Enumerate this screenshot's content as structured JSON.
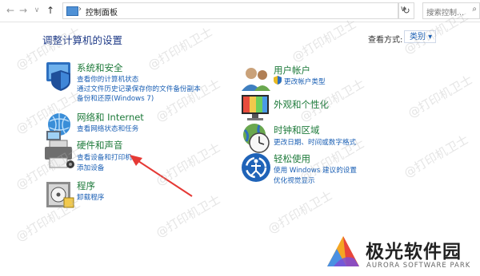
{
  "address_bar": {
    "back": "←",
    "forward": "→",
    "history": "∨",
    "up": "↑",
    "location": "控制面板",
    "separator": "›",
    "dropdown": "∨",
    "refresh": "↻",
    "search_placeholder": "搜索控制..."
  },
  "header": {
    "title": "调整计算机的设置",
    "view_by_label": "查看方式:",
    "view_by_value": "类别 ▾"
  },
  "categories_left": [
    {
      "title": "系统和安全",
      "links": [
        "查看你的计算机状态",
        "通过文件历史记录保存你的文件备份副本",
        "备份和还原(Windows 7)"
      ]
    },
    {
      "title": "网络和 Internet",
      "links": [
        "查看网络状态和任务"
      ]
    },
    {
      "title": "硬件和声音",
      "links": [
        "查看设备和打印机",
        "添加设备"
      ]
    },
    {
      "title": "程序",
      "links": [
        "卸载程序"
      ]
    }
  ],
  "categories_right": [
    {
      "title": "用户帐户",
      "links": [
        "更改帐户类型"
      ]
    },
    {
      "title": "外观和个性化",
      "links": []
    },
    {
      "title": "时钟和区域",
      "links": [
        "更改日期、时间或数字格式"
      ]
    },
    {
      "title": "轻松使用",
      "links": [
        "使用 Windows 建议的设置",
        "优化视觉显示"
      ]
    }
  ],
  "watermark": "@打印机卫士",
  "branding": {
    "name": "极光软件园",
    "sub": "AURORA SOFTWARE PARK"
  },
  "colors": {
    "category_title": "#1d7a3a",
    "link": "#1a5fb4",
    "arrow": "#e53935"
  }
}
